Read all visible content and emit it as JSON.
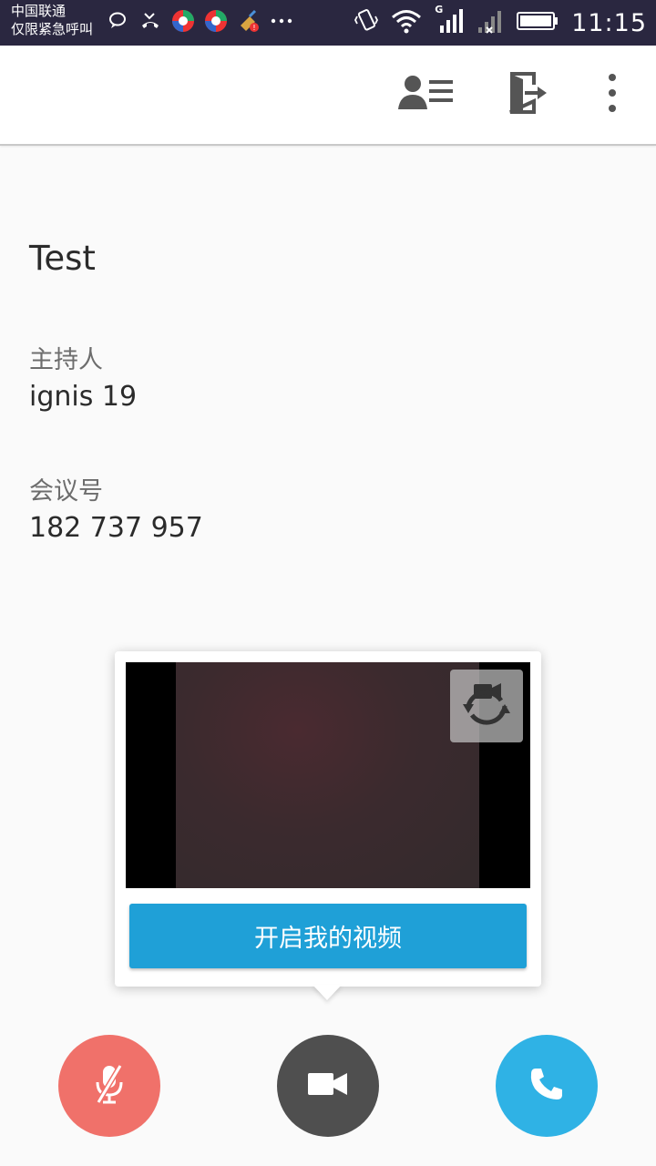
{
  "status_bar": {
    "carrier_line1": "中国联通",
    "carrier_line2": "仅限紧急呼叫",
    "network_type": "G",
    "time": "11:15",
    "icons": [
      "chat-bubble-icon",
      "missed-call-icon",
      "app-icon",
      "app-icon",
      "cleaner-icon",
      "more-dots-icon",
      "vibrate-icon",
      "wifi-icon",
      "signal-icon",
      "signal-x-icon",
      "battery-icon"
    ]
  },
  "app_bar": {
    "icons": [
      "participants-list-icon",
      "exit-icon",
      "overflow-menu-icon"
    ]
  },
  "meeting": {
    "title": "Test",
    "host_label": "主持人",
    "host_value": "ignis 19",
    "id_label": "会议号",
    "id_value": "182 737 957"
  },
  "video_card": {
    "start_video_label": "开启我的视频",
    "switch_camera_icon": "switch-camera-icon"
  },
  "controls": {
    "mute_icon": "mic-off-icon",
    "video_icon": "video-camera-icon",
    "call_icon": "phone-icon",
    "colors": {
      "mute": "#f0716a",
      "video": "#4f4f4f",
      "call": "#2fb2e5",
      "accent": "#1fa0d7"
    }
  }
}
